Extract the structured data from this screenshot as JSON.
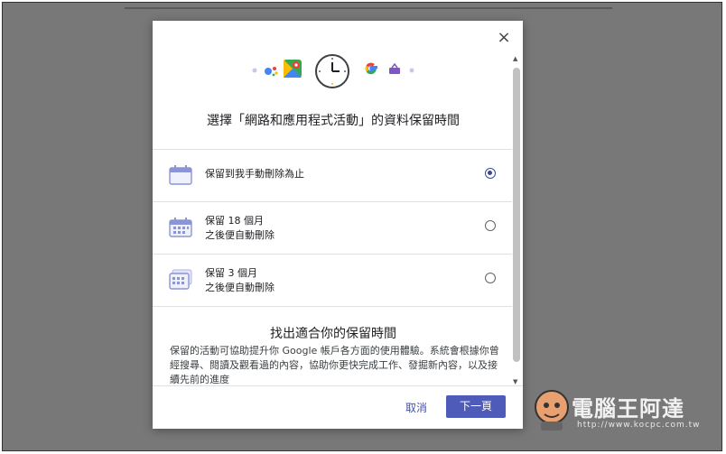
{
  "dialog": {
    "title": "選擇「網路和應用程式活動」的資料保留時間",
    "close_label": "×"
  },
  "header_icons": [
    "google-assistant-icon",
    "google-maps-icon",
    "clock-icon",
    "google-logo-icon",
    "shopping-basket-icon"
  ],
  "options": [
    {
      "line1": "保留到我手動刪除為止",
      "line2": "",
      "selected": true,
      "icon": "calendar-blank-icon"
    },
    {
      "line1": "保留 18 個月",
      "line2": "之後便自動刪除",
      "selected": false,
      "icon": "calendar-grid-icon"
    },
    {
      "line1": "保留 3 個月",
      "line2": "之後便自動刪除",
      "selected": false,
      "icon": "calendar-stack-icon"
    }
  ],
  "info": {
    "title": "找出適合你的保留時間",
    "body": "保留的活動可協助提升你 Google 帳戶各方面的使用體驗。系統會根據你曾經搜尋、閱讀及觀看過的內容，協助你更快完成工作、發掘新內容，以及接續先前的進度"
  },
  "footer": {
    "cancel_label": "取消",
    "next_label": "下一頁"
  },
  "watermark": {
    "text": "電腦王阿達",
    "url": "http://www.kocpc.com.tw"
  },
  "colors": {
    "accent": "#4f5bb8",
    "radio_selected": "#3c4799",
    "calendar_icon": "#8a94d6",
    "backdrop": "#787878"
  }
}
